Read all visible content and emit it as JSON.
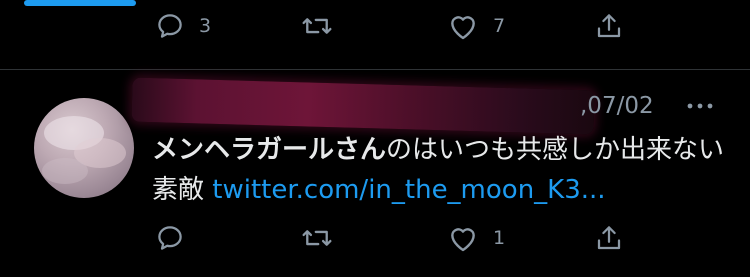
{
  "top_actions": {
    "reply_count": "3",
    "retweet_count": "",
    "like_count": "7"
  },
  "tweet": {
    "date": ",07/02",
    "mention_bold": "メンヘラガールさん",
    "text_rest": "のはいつも共感しか出来ない素敵 ",
    "link": "twitter.com/in_the_moon_K3...",
    "actions": {
      "reply_count": "",
      "retweet_count": "",
      "like_count": "1"
    }
  },
  "colors": {
    "background": "#000000",
    "text": "#e7e9ea",
    "muted": "#8b98a5",
    "link": "#1d9bf0",
    "divider": "#2f3336"
  },
  "icons": [
    "reply-icon",
    "retweet-icon",
    "like-icon",
    "share-icon",
    "more-icon"
  ]
}
